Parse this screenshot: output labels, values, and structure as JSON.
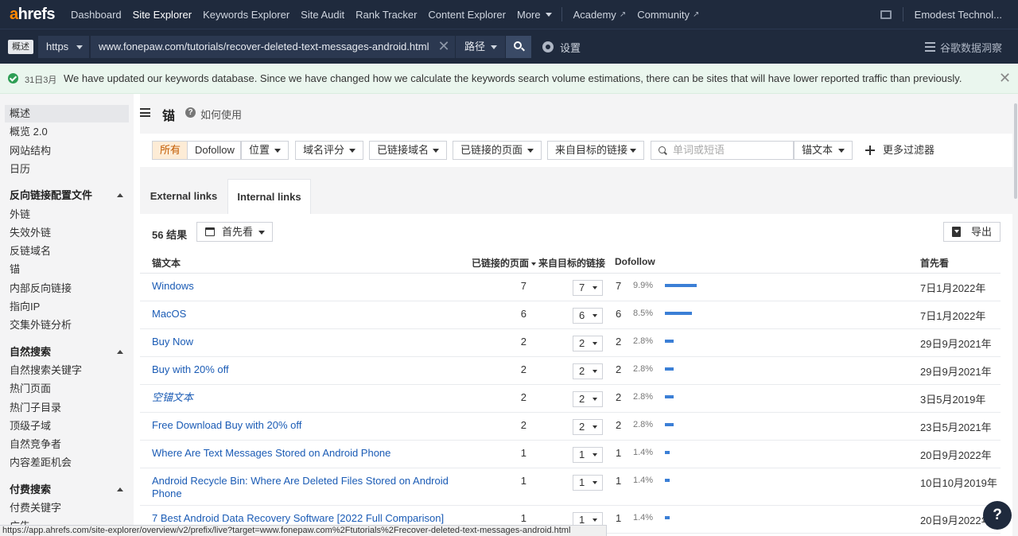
{
  "nav": {
    "logo_accent": "a",
    "logo_rest": "hrefs",
    "items": [
      "Dashboard",
      "Site Explorer",
      "Keywords Explorer",
      "Site Audit",
      "Rank Tracker",
      "Content Explorer",
      "More"
    ],
    "active": "Site Explorer",
    "academy": "Academy",
    "community": "Community",
    "account": "Emodest Technol..."
  },
  "urlbar": {
    "mode_badge": "概述",
    "protocol": "https",
    "url": "www.fonepaw.com/tutorials/recover-deleted-text-messages-android.html",
    "scope": "路径",
    "settings": "设置",
    "gsc": "谷歌数据洞察"
  },
  "banner": {
    "date": "31日3月",
    "text": "We have updated our keywords database. Since we have changed how we calculate the keywords search volume estimations, there can be sites that will have lower reported traffic than previously."
  },
  "sidebar": {
    "top_items": [
      "概述",
      "概览 2.0",
      "网站结构",
      "日历"
    ],
    "sections": [
      {
        "title": "反向链接配置文件",
        "items": [
          "外链",
          "失效外链",
          "反链域名",
          "锚",
          "内部反向链接",
          "指向IP",
          "交集外链分析"
        ]
      },
      {
        "title": "自然搜索",
        "items": [
          "自然搜索关键字",
          "热门页面",
          "热门子目录",
          "顶级子域",
          "自然竞争者",
          "内容差距机会"
        ]
      },
      {
        "title": "付费搜索",
        "items": [
          "付费关键字",
          "广告"
        ]
      }
    ]
  },
  "page": {
    "title": "锚",
    "help": "如何使用"
  },
  "filters": {
    "all": "所有",
    "dofollow": "Dofollow",
    "position": "位置",
    "domain_rating": "域名评分",
    "linked_domains": "已链接域名",
    "linked_pages": "已链接的页面",
    "links_from_target": "来自目标的链接",
    "keyword_placeholder": "单词或短语",
    "anchor_text": "锚文本",
    "more_filters": "更多过滤器"
  },
  "tabs": [
    "External links",
    "Internal links"
  ],
  "table": {
    "results_count": "56 结果",
    "first_seen_btn": "首先看",
    "export": "导出",
    "headers": {
      "anchor": "锚文本",
      "linked_pages": "已链接的页面",
      "links_from_target": "来自目标的链接",
      "dofollow": "Dofollow",
      "first_seen": "首先看"
    },
    "rows": [
      {
        "anchor": "Windows",
        "pages": "7",
        "links": "7",
        "dofollow": "7",
        "pct": "9.9%",
        "share": 9.9,
        "date": "7日1月2022年",
        "italic": false
      },
      {
        "anchor": "MacOS",
        "pages": "6",
        "links": "6",
        "dofollow": "6",
        "pct": "8.5%",
        "share": 8.5,
        "date": "7日1月2022年",
        "italic": false
      },
      {
        "anchor": "Buy Now",
        "pages": "2",
        "links": "2",
        "dofollow": "2",
        "pct": "2.8%",
        "share": 2.8,
        "date": "29日9月2021年",
        "italic": false
      },
      {
        "anchor": "Buy with 20% off",
        "pages": "2",
        "links": "2",
        "dofollow": "2",
        "pct": "2.8%",
        "share": 2.8,
        "date": "29日9月2021年",
        "italic": false
      },
      {
        "anchor": "空锚文本",
        "pages": "2",
        "links": "2",
        "dofollow": "2",
        "pct": "2.8%",
        "share": 2.8,
        "date": "3日5月2019年",
        "italic": true
      },
      {
        "anchor": "Free Download Buy with 20% off",
        "pages": "2",
        "links": "2",
        "dofollow": "2",
        "pct": "2.8%",
        "share": 2.8,
        "date": "23日5月2021年",
        "italic": false
      },
      {
        "anchor": "Where Are Text Messages Stored on Android Phone",
        "pages": "1",
        "links": "1",
        "dofollow": "1",
        "pct": "1.4%",
        "share": 1.4,
        "date": "20日9月2022年",
        "italic": false
      },
      {
        "anchor": "Android Recycle Bin: Where Are Deleted Files Stored on Android Phone",
        "pages": "1",
        "links": "1",
        "dofollow": "1",
        "pct": "1.4%",
        "share": 1.4,
        "date": "10日10月2019年",
        "italic": false
      },
      {
        "anchor": "7 Best Android Data Recovery Software [2022 Full Comparison]",
        "pages": "1",
        "links": "1",
        "dofollow": "1",
        "pct": "1.4%",
        "share": 1.4,
        "date": "20日9月2022年",
        "italic": false
      }
    ]
  },
  "statusbar": "https://app.ahrefs.com/site-explorer/overview/v2/prefix/live?target=www.fonepaw.com%2Ftutorials%2Frecover-deleted-text-messages-android.html",
  "help_fab": "?",
  "colors": {
    "nav_bg": "#1f2a3d",
    "link": "#1a5bb5",
    "bar": "#3b7fd6",
    "selected_filter_bg": "#fdecd6",
    "banner_bg": "#eaf6ee"
  }
}
